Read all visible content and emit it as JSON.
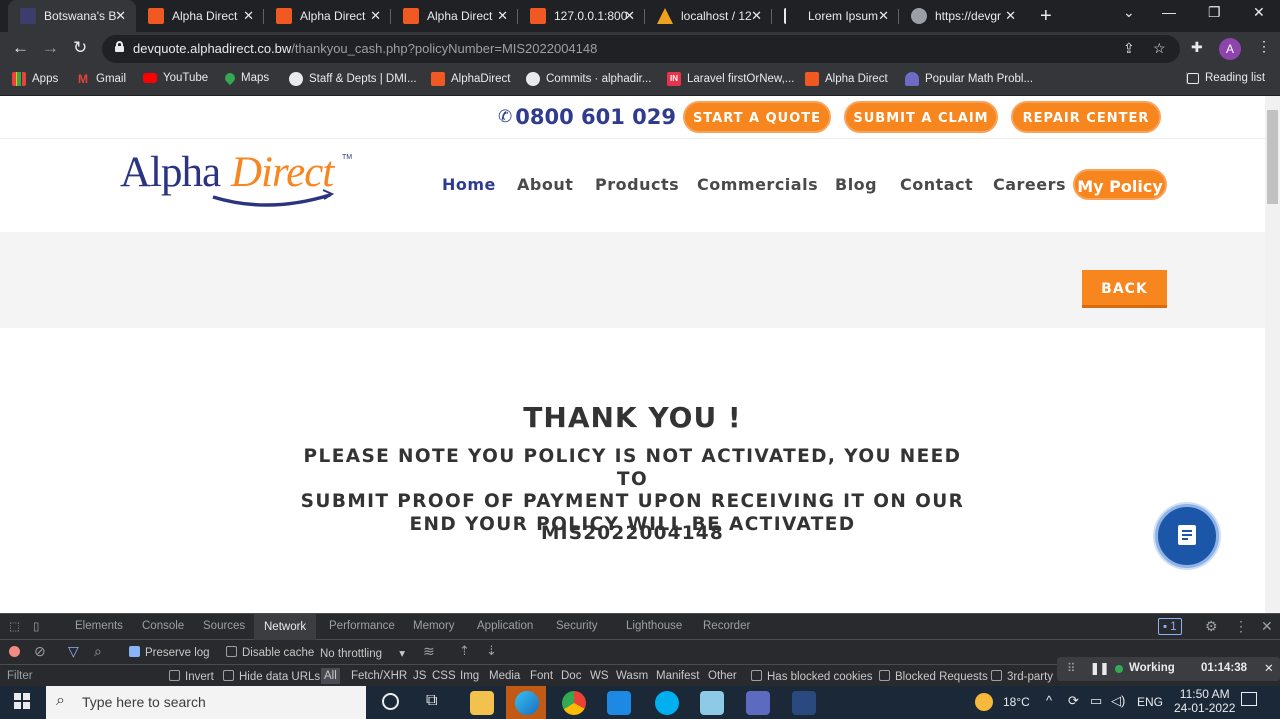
{
  "browser": {
    "tabs": [
      {
        "title": "Botswana's B",
        "color": "#3d3d6b"
      },
      {
        "title": "Alpha Direct",
        "color": "#f05a22"
      },
      {
        "title": "Alpha Direct",
        "color": "#f05a22"
      },
      {
        "title": "Alpha Direct",
        "color": "#f05a22"
      },
      {
        "title": "127.0.0.1:800",
        "color": "#f05a22"
      },
      {
        "title": "localhost / 12",
        "color": "#f0a020"
      },
      {
        "title": "Lorem Ipsum",
        "color": "#e8eaed"
      },
      {
        "title": "https://devgr",
        "color": "#9aa0a6"
      }
    ],
    "url_host": "devquote.alphadirect.co.bw",
    "url_path": "/thankyou_cash.php?policyNumber=MIS2022004148",
    "profile_initial": "A",
    "bookmarks": [
      "Apps",
      "Gmail",
      "YouTube",
      "Maps",
      "Staff & Depts | DMI...",
      "AlphaDirect",
      "Commits · alphadir...",
      "Laravel firstOrNew,...",
      "Alpha Direct",
      "Popular Math Probl..."
    ],
    "reading_list": "Reading list"
  },
  "site": {
    "phone": "0800 601 029",
    "top_buttons": [
      "START A QUOTE",
      "SUBMIT A CLAIM",
      "REPAIR CENTER"
    ],
    "logo_alpha": "Alpha",
    "logo_direct": "Direct",
    "logo_tm": "TM",
    "nav": [
      "Home",
      "About",
      "Products",
      "Commercials",
      "Blog",
      "Contact",
      "Careers"
    ],
    "my_policy": "My Policy",
    "back": "BACK",
    "thanks": "THANK YOU !",
    "note_lines": [
      "PLEASE NOTE YOU POLICY IS NOT ACTIVATED, YOU NEED TO",
      "SUBMIT PROOF OF PAYMENT UPON RECEIVING IT ON OUR",
      "END YOUR POLICY WILL BE ACTIVATED"
    ],
    "policy_number": "MIS2022004148",
    "brand_orange": "#f7861e",
    "brand_blue": "#2e3b8f"
  },
  "devtools": {
    "tabs": [
      "Elements",
      "Console",
      "Sources",
      "Network",
      "Performance",
      "Memory",
      "Application",
      "Security",
      "Lighthouse",
      "Recorder"
    ],
    "active_tab": "Network",
    "issues_count": "1",
    "preserve_log": "Preserve log",
    "disable_cache": "Disable cache",
    "throttling": "No throttling",
    "filter_placeholder": "Filter",
    "invert": "Invert",
    "hide_data_urls": "Hide data URLs",
    "types": [
      "All",
      "Fetch/XHR",
      "JS",
      "CSS",
      "Img",
      "Media",
      "Font",
      "Doc",
      "WS",
      "Wasm",
      "Manifest",
      "Other"
    ],
    "has_blocked_cookies": "Has blocked cookies",
    "blocked_requests": "Blocked Requests",
    "third_party": "3rd-party",
    "recorder_status": "Working",
    "recorder_time": "01:14:38"
  },
  "taskbar": {
    "search_placeholder": "Type here to search",
    "temperature": "18°C",
    "language": "ENG",
    "time": "11:50 AM",
    "date": "24-01-2022"
  }
}
